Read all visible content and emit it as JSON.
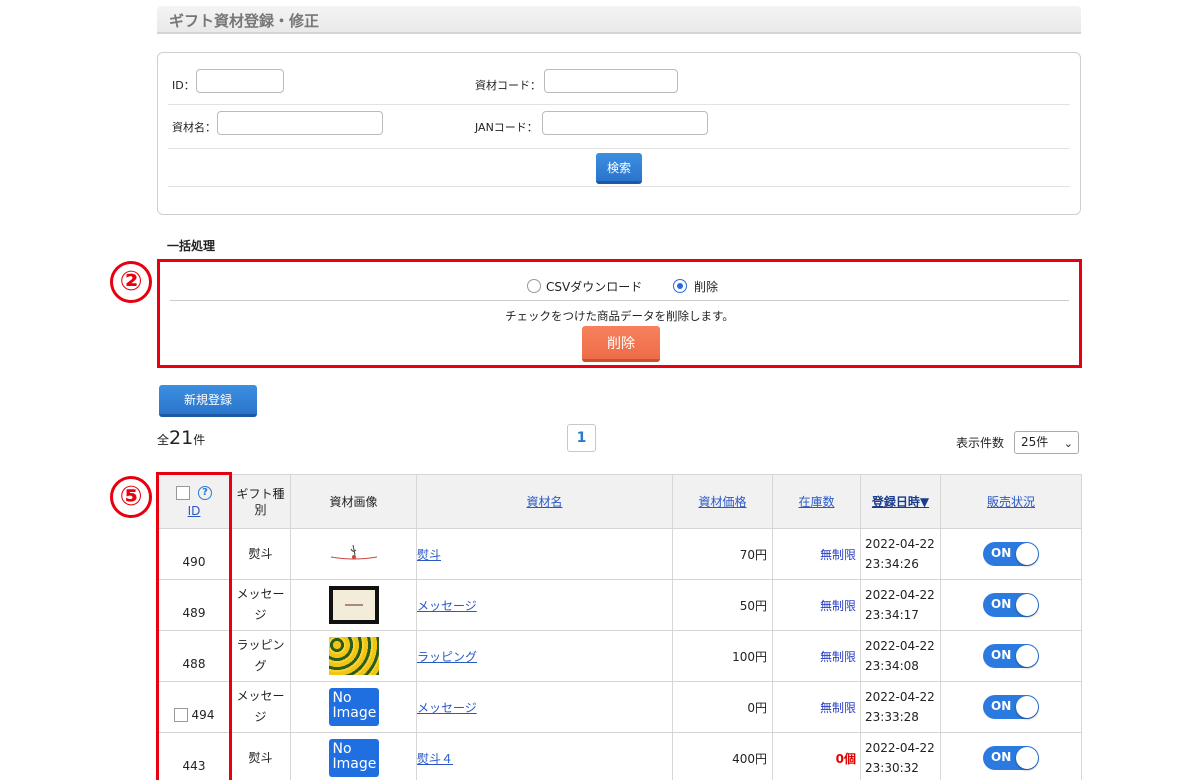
{
  "header": {
    "title": "ギフト資材登録・修正"
  },
  "search": {
    "id_label": "ID：",
    "code_label": "資材コード：",
    "name_label": "資材名：",
    "jan_label": "JANコード：",
    "button_label": "検索"
  },
  "bulk": {
    "title": "一括処理",
    "option_csv": "CSVダウンロード",
    "option_delete": "削除",
    "selected_option": "削除",
    "description": "チェックをつけた商品データを削除します。",
    "action_label": "削除"
  },
  "annotations": {
    "box2": "②",
    "box5": "⑤"
  },
  "new_button": "新規登録",
  "totals": {
    "prefix": "全",
    "count": "21",
    "suffix": "件"
  },
  "pagination": {
    "current": "1"
  },
  "per_page": {
    "label": "表示件数",
    "value": "25件"
  },
  "table": {
    "headers": {
      "id": "ID",
      "type": "ギフト種別",
      "image": "資材画像",
      "name": "資材名",
      "price": "資材価格",
      "stock": "在庫数",
      "date": "登録日時▼",
      "status": "販売状況"
    },
    "rows": [
      {
        "id": "490",
        "type": "熨斗",
        "image": "noshi-image",
        "name": "熨斗",
        "price": "70円",
        "stock": "無制限",
        "date1": "2022-04-22",
        "date2": "23:34:26",
        "status": "ON"
      },
      {
        "id": "489",
        "type": "メッセージ",
        "image": "message-card-image",
        "name": "メッセージ",
        "price": "50円",
        "stock": "無制限",
        "date1": "2022-04-22",
        "date2": "23:34:17",
        "status": "ON"
      },
      {
        "id": "488",
        "type": "ラッピング",
        "image": "sunflower-image",
        "name": "ラッピング",
        "price": "100円",
        "stock": "無制限",
        "date1": "2022-04-22",
        "date2": "23:34:08",
        "status": "ON"
      },
      {
        "id": "494",
        "type": "メッセージ",
        "image": "no-image",
        "name": "メッセージ",
        "price": "0円",
        "stock": "無制限",
        "date1": "2022-04-22",
        "date2": "23:33:28",
        "status": "ON"
      },
      {
        "id": "443",
        "type": "熨斗",
        "image": "no-image",
        "name": "熨斗４",
        "price": "400円",
        "stock": "0個",
        "date1": "2022-04-22",
        "date2": "23:30:32",
        "status": "ON"
      }
    ],
    "no_image_text": "No Image"
  },
  "colors": {
    "accent": "#2a75cc",
    "delete": "#ee6c48",
    "annotation": "#e8000e",
    "zero_stock": "#e00000"
  }
}
